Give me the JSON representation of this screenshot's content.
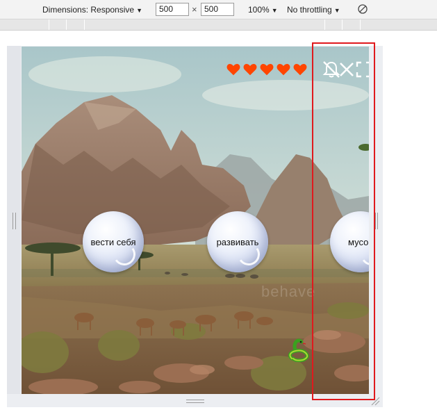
{
  "toolbar": {
    "dimensions_label": "Dimensions: Responsive",
    "width_value": "500",
    "times_symbol": "×",
    "height_value": "500",
    "zoom_label": "100%",
    "throttling_label": "No throttling",
    "caret": "▼"
  },
  "game": {
    "lives": 5,
    "heart_color": "#ff4500",
    "controls": [
      "mute-icon",
      "close-icon",
      "fullscreen-icon"
    ],
    "words": [
      {
        "label": "вести себя"
      },
      {
        "label": "развивать"
      },
      {
        "label": "мусо"
      }
    ],
    "watermark_text": "behave"
  },
  "colors": {
    "highlight_border": "#e0191d",
    "toolbar_bg": "#f3f3f3",
    "ruler_bg": "#e6e6e6"
  }
}
